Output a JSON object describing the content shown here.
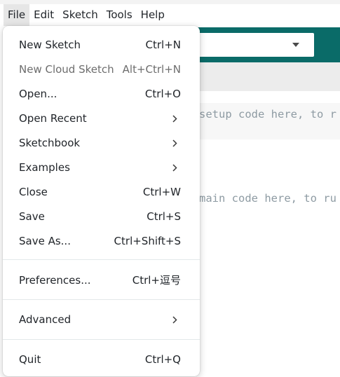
{
  "menubar": {
    "items": [
      "File",
      "Edit",
      "Sketch",
      "Tools",
      "Help"
    ]
  },
  "editor": {
    "line1": "setup code here, to r",
    "line2": "main code here, to ru"
  },
  "file_menu": {
    "new_sketch": {
      "label": "New Sketch",
      "shortcut": "Ctrl+N"
    },
    "new_cloud_sketch": {
      "label": "New Cloud Sketch",
      "shortcut": "Alt+Ctrl+N"
    },
    "open": {
      "label": "Open...",
      "shortcut": "Ctrl+O"
    },
    "open_recent": {
      "label": "Open Recent"
    },
    "sketchbook": {
      "label": "Sketchbook"
    },
    "examples": {
      "label": "Examples"
    },
    "close": {
      "label": "Close",
      "shortcut": "Ctrl+W"
    },
    "save": {
      "label": "Save",
      "shortcut": "Ctrl+S"
    },
    "save_as": {
      "label": "Save As...",
      "shortcut": "Ctrl+Shift+S"
    },
    "preferences": {
      "label": "Preferences...",
      "shortcut": "Ctrl+逗号"
    },
    "advanced": {
      "label": "Advanced"
    },
    "quit": {
      "label": "Quit",
      "shortcut": "Ctrl+Q"
    }
  },
  "icons": {
    "submenu": "chevron-right-icon",
    "board_select": "caret-down-icon"
  },
  "colors": {
    "toolbar": "#0a6b68",
    "menu_bg": "#ffffff",
    "disabled_text": "#6d6d6d"
  }
}
